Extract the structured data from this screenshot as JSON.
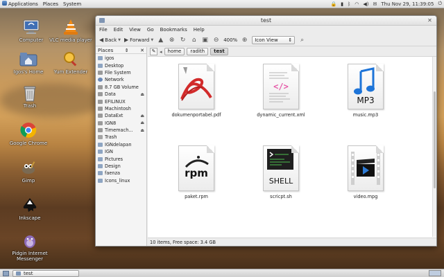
{
  "top_panel": {
    "menus": [
      "Applications",
      "Places",
      "System"
    ],
    "clock": "Thu Nov 29, 11:39:05"
  },
  "desktop": {
    "icons": [
      {
        "label": "Computer",
        "icon": "computer-icon"
      },
      {
        "label": "VLC media player",
        "icon": "vlc-icon"
      },
      {
        "label": "Igos's Home",
        "icon": "home-folder-icon"
      },
      {
        "label": "Yum Extender",
        "icon": "yum-extender-icon"
      },
      {
        "label": "Trash",
        "icon": "trash-icon"
      },
      {
        "label": "Google Chrome",
        "icon": "chrome-icon"
      },
      {
        "label": "Gimp",
        "icon": "gimp-icon"
      },
      {
        "label": "Inkscape",
        "icon": "inkscape-icon"
      },
      {
        "label": "Pidgin Internet Messenger",
        "icon": "pidgin-icon"
      }
    ]
  },
  "window": {
    "title": "test",
    "menubar": [
      "File",
      "Edit",
      "View",
      "Go",
      "Bookmarks",
      "Help"
    ],
    "toolbar": {
      "back_label": "Back",
      "forward_label": "Forward",
      "zoom": "400%",
      "view_mode": "Icon View"
    },
    "sidebar": {
      "header": "Places",
      "items": [
        {
          "label": "igos",
          "kind": "folder",
          "eject": false
        },
        {
          "label": "Desktop",
          "kind": "folder",
          "eject": false
        },
        {
          "label": "File System",
          "kind": "device",
          "eject": false
        },
        {
          "label": "Network",
          "kind": "network",
          "eject": false
        },
        {
          "label": "8.7 GB Volume",
          "kind": "device",
          "eject": false
        },
        {
          "label": "Data",
          "kind": "device",
          "eject": true
        },
        {
          "label": "EFILINUX",
          "kind": "device",
          "eject": false
        },
        {
          "label": "Machintosh",
          "kind": "device",
          "eject": false
        },
        {
          "label": "DataExt",
          "kind": "device",
          "eject": true
        },
        {
          "label": "IGN8",
          "kind": "device",
          "eject": true
        },
        {
          "label": "Timemach...",
          "kind": "device",
          "eject": true
        },
        {
          "label": "Trash",
          "kind": "trash",
          "eject": false
        },
        {
          "label": "IGNdelapan",
          "kind": "folder",
          "eject": false
        },
        {
          "label": "IGN",
          "kind": "folder",
          "eject": false
        },
        {
          "label": "Pictures",
          "kind": "folder",
          "eject": false
        },
        {
          "label": "Design",
          "kind": "folder",
          "eject": false
        },
        {
          "label": "faenza",
          "kind": "folder",
          "eject": false
        },
        {
          "label": "Icons_linux",
          "kind": "folder",
          "eject": false
        }
      ]
    },
    "pathbar": {
      "crumbs": [
        "home",
        "radith",
        "test"
      ],
      "active": "test"
    },
    "files": [
      {
        "name": "dokumenportabel.pdf",
        "type": "pdf"
      },
      {
        "name": "dynamic_current.xml",
        "type": "xml"
      },
      {
        "name": "music.mp3",
        "type": "mp3",
        "badge": "MP3"
      },
      {
        "name": "paket.rpm",
        "type": "rpm",
        "badge": "rpm"
      },
      {
        "name": "scricpt.sh",
        "type": "shell",
        "badge": "SHELL"
      },
      {
        "name": "video.mpg",
        "type": "video"
      }
    ],
    "status": "10 items, Free space: 3.4 GB"
  },
  "taskbar": {
    "items": [
      {
        "label": "test"
      }
    ]
  }
}
